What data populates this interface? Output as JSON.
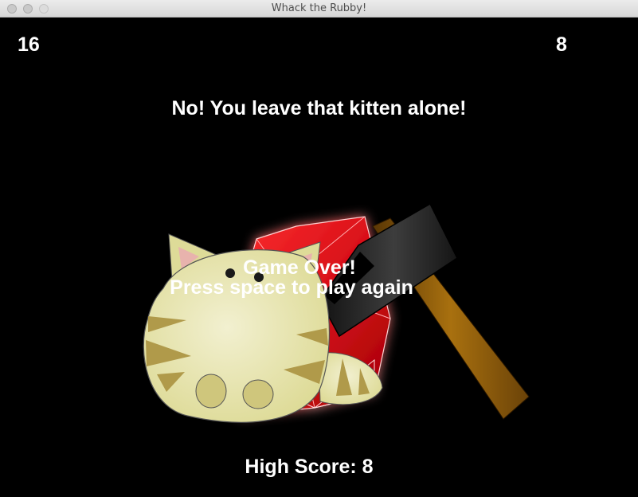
{
  "window": {
    "title": "Whack the Rubby!"
  },
  "hud": {
    "score": "16",
    "timer": "8"
  },
  "message": "No! You leave that kitten alone!",
  "game_over": {
    "line1": "Game Over!",
    "line2": "Press space to play again"
  },
  "high_score": {
    "text": "High Score: 8"
  },
  "sprites": {
    "kitten": "kitten-icon",
    "ruby": "ruby-gem-icon",
    "hammer": "hammer-icon"
  },
  "colors": {
    "background": "#000000",
    "text": "#ffffff",
    "ruby": "#e0121c",
    "kitten_body": "#e6e3a8",
    "kitten_stripes": "#b0a050",
    "hammer_handle": "#8a5a10",
    "hammer_head": "#2a2a2a"
  }
}
